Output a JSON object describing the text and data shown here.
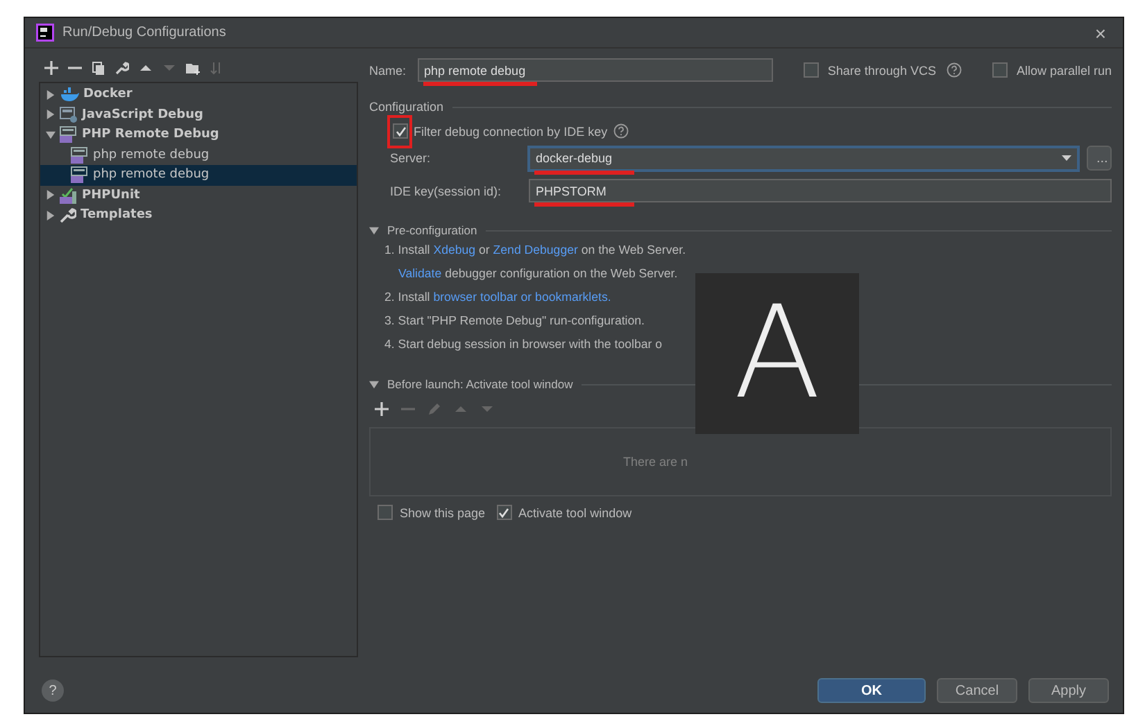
{
  "window": {
    "title": "Run/Debug Configurations",
    "close": "×"
  },
  "tree": [
    {
      "label": "Docker",
      "kind": "docker",
      "expanded": false,
      "selected": false
    },
    {
      "label": "JavaScript Debug",
      "kind": "js",
      "expanded": false,
      "selected": false
    },
    {
      "label": "PHP Remote Debug",
      "kind": "php",
      "expanded": true,
      "selected": false,
      "children": [
        {
          "label": "php remote debug",
          "kind": "php",
          "selected": false
        },
        {
          "label": "php remote debug",
          "kind": "php",
          "selected": true
        }
      ]
    },
    {
      "label": "PHPUnit",
      "kind": "phpunit",
      "expanded": false,
      "selected": false
    },
    {
      "label": "Templates",
      "kind": "wrench",
      "expanded": false,
      "selected": false
    }
  ],
  "name_field": {
    "label": "Name:",
    "value": "php remote debug",
    "annotated": true
  },
  "share_vcs": {
    "label": "Share through VCS",
    "checked": false
  },
  "allow_parallel": {
    "label": "Allow parallel run",
    "checked": false
  },
  "configuration": {
    "heading": "Configuration",
    "filter": {
      "label": "Filter debug connection by IDE key",
      "checked": true,
      "annotated": true
    },
    "server": {
      "label": "Server:",
      "value": "docker-debug",
      "browse": "...",
      "annotated": true
    },
    "ide_key": {
      "label": "IDE key(session id):",
      "value": "PHPSTORM",
      "annotated": true
    }
  },
  "preconfiguration": {
    "heading": "Pre-configuration",
    "expanded": true,
    "steps": [
      [
        {
          "text": "1. Install "
        },
        {
          "text": "Xdebug",
          "link": true
        },
        {
          "text": " or "
        },
        {
          "text": "Zend Debugger",
          "link": true
        },
        {
          "text": " on the Web Server."
        }
      ],
      [
        {
          "text": "Validate",
          "link": true
        },
        {
          "text": " debugger configuration on the Web Server."
        }
      ],
      [
        {
          "text": "2. Install "
        },
        {
          "text": "browser toolbar or bookmarklets.",
          "link": true
        }
      ],
      [
        {
          "text": "3. Start \"PHP Remote Debug\" run-configuration."
        }
      ],
      [
        {
          "text": "4. Start debug session in browser with the toolbar o"
        }
      ]
    ]
  },
  "before_launch": {
    "heading": "Before launch: Activate tool window",
    "expanded": true,
    "empty_text": "There are n",
    "options": [
      {
        "label": "Show this page",
        "checked": false
      },
      {
        "label": "Activate tool window",
        "checked": true
      }
    ]
  },
  "overlay": {
    "letter": "A"
  },
  "help": "?",
  "buttons": [
    {
      "label": "OK",
      "default": true
    },
    {
      "label": "Cancel",
      "default": false
    },
    {
      "label": "Apply",
      "default": false
    }
  ]
}
